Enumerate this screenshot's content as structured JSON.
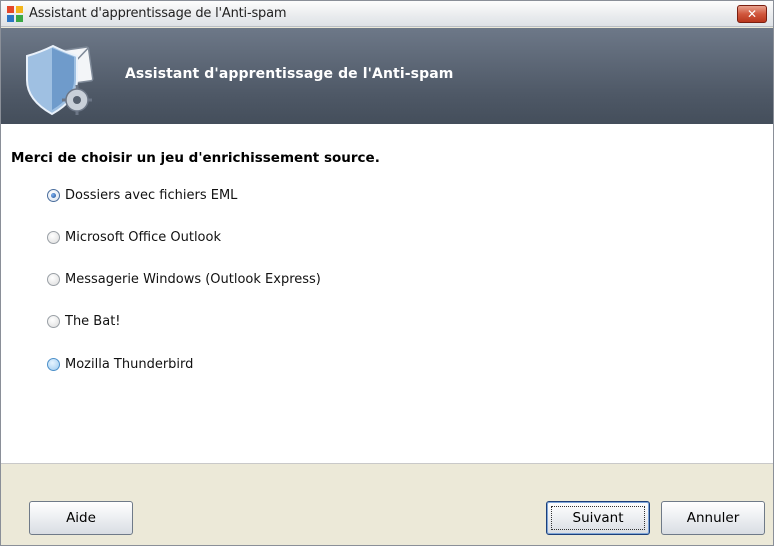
{
  "window": {
    "title": "Assistant d'apprentissage de l'Anti-spam",
    "close_label": "✕"
  },
  "banner": {
    "title": "Assistant d'apprentissage de l'Anti-spam"
  },
  "content": {
    "prompt": "Merci de choisir un jeu d'enrichissement source.",
    "options": [
      {
        "label": "Dossiers avec fichiers EML",
        "checked": true
      },
      {
        "label": "Microsoft Office Outlook",
        "checked": false
      },
      {
        "label": "Messagerie Windows (Outlook Express)",
        "checked": false
      },
      {
        "label": "The Bat!",
        "checked": false
      },
      {
        "label": "Mozilla Thunderbird",
        "checked": false,
        "hovered": true
      }
    ]
  },
  "footer": {
    "help_label": "Aide",
    "next_label": "Suivant",
    "cancel_label": "Annuler"
  },
  "colors": {
    "banner": "#56606e",
    "close_button": "#d0573d",
    "radio_selected": "#1e4f96"
  }
}
